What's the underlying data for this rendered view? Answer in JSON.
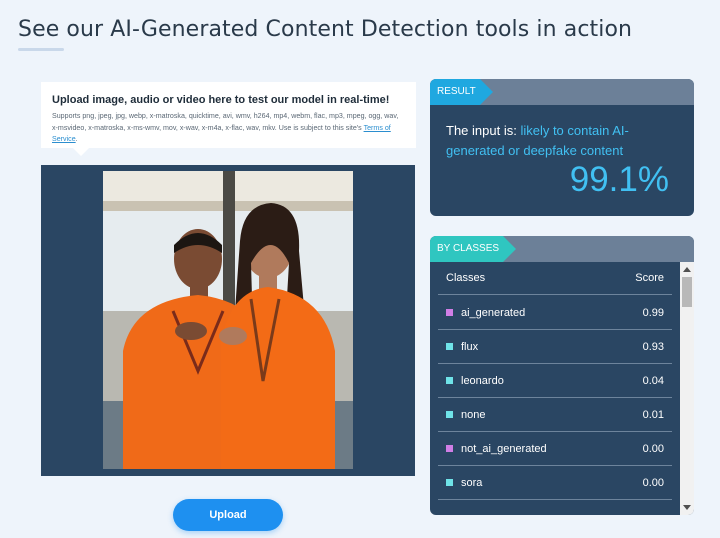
{
  "page": {
    "title": "See our AI-Generated Content Detection tools in action"
  },
  "upload": {
    "heading": "Upload image, audio or video here to test our model in real-time!",
    "supported_text": "Supports png, jpeg, jpg, webp, x-matroska, quicktime, avi, wmv, h264, mp4, webm, flac, mp3, mpeg, ogg, wav, x-msvideo, x-matroska, x-ms-wmv, mov, x-wav, x-m4a, x-flac, wav, mkv. Use is subject to this site's ",
    "terms_link": "Terms of Service",
    "terms_suffix": ".",
    "button_label": "Upload"
  },
  "result": {
    "tag": "RESULT",
    "prefix": "The input is: ",
    "verdict": "likely to contain AI-generated or deepfake content",
    "score": "99.1%"
  },
  "classes": {
    "tag": "BY CLASSES",
    "column_class": "Classes",
    "column_score": "Score",
    "rows": [
      {
        "name": "ai_generated",
        "score": "0.99",
        "color": "#d07ee6"
      },
      {
        "name": "flux",
        "score": "0.93",
        "color": "#6fe3e8"
      },
      {
        "name": "leonardo",
        "score": "0.04",
        "color": "#6fe3e8"
      },
      {
        "name": "none",
        "score": "0.01",
        "color": "#6fe3e8"
      },
      {
        "name": "not_ai_generated",
        "score": "0.00",
        "color": "#d07ee6"
      },
      {
        "name": "sora",
        "score": "0.00",
        "color": "#6fe3e8"
      }
    ]
  },
  "colors": {
    "accent_blue": "#1e90f0",
    "panel_navy": "#2a4663",
    "result_cyan": "#41c0f2",
    "classes_teal": "#2fc6c0"
  }
}
